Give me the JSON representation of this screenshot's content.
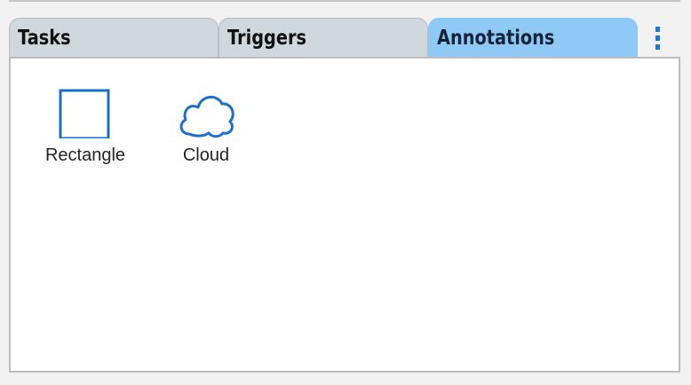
{
  "tabs": [
    {
      "label": "Tasks",
      "active": false
    },
    {
      "label": "Triggers",
      "active": false
    },
    {
      "label": "Annotations",
      "active": true
    }
  ],
  "more_menu_icon": "vertical-ellipsis-icon",
  "items": [
    {
      "label": "Rectangle",
      "icon": "rectangle-icon"
    },
    {
      "label": "Cloud",
      "icon": "cloud-icon"
    }
  ],
  "colors": {
    "accent": "#1b78d8",
    "active_tab": "#8fcaf6",
    "inactive_tab": "#cfd8dd",
    "panel_background": "#ffffff"
  }
}
